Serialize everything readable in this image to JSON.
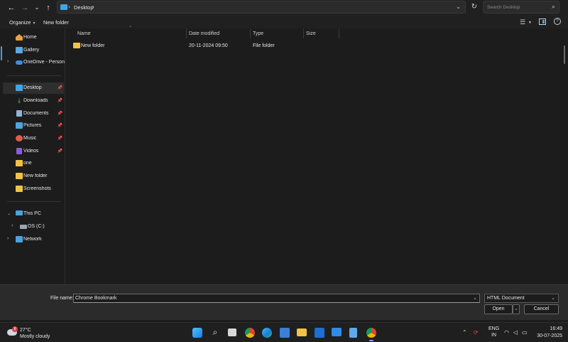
{
  "address": {
    "path": "Desktop",
    "search_placeholder": "Search Desktop"
  },
  "toolbar": {
    "organize": "Organize",
    "new_folder": "New folder"
  },
  "nav": {
    "home": "Home",
    "gallery": "Gallery",
    "onedrive": "OneDrive - Persona",
    "desktop": "Desktop",
    "downloads": "Downloads",
    "documents": "Documents",
    "pictures": "Pictures",
    "music": "Music",
    "videos": "Videos",
    "one": "one",
    "new_folder": "New folder",
    "screenshots": "Screenshots",
    "this_pc": "This PC",
    "os_c": "OS (C:)",
    "network": "Network"
  },
  "columns": {
    "name": "Name",
    "date_modified": "Date modified",
    "type": "Type",
    "size": "Size"
  },
  "files": [
    {
      "name": "New folder",
      "date": "20-11-2024 09:50",
      "type": "File folder",
      "size": ""
    }
  ],
  "dialog": {
    "file_name_label": "File name:",
    "file_name_value": "Chrome Bookmark",
    "file_type": "HTML Document",
    "open": "Open",
    "cancel": "Cancel"
  },
  "taskbar": {
    "weather_badge": "8",
    "weather_temp": "27°C",
    "weather_desc": "Mostly cloudy",
    "lang_top": "ENG",
    "lang_bottom": "IN",
    "time": "16:49",
    "date": "30-07-2025"
  },
  "colors": {
    "accent": "#4b9be0",
    "folder": "#f0c346"
  }
}
